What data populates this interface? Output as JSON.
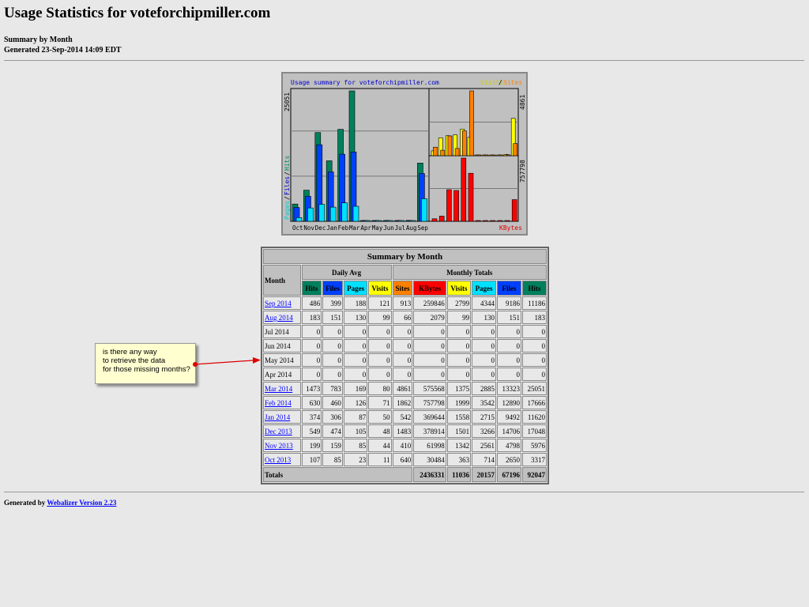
{
  "header": {
    "title": "Usage Statistics for voteforchipmiller.com",
    "subtitle": "Summary by Month",
    "generated": "Generated 23-Sep-2014 14:09 EDT"
  },
  "chart_data": {
    "type": "bar",
    "title": "Usage summary for voteforchipmiller.com",
    "categories": [
      "Oct",
      "Nov",
      "Dec",
      "Jan",
      "Feb",
      "Mar",
      "Apr",
      "May",
      "Jun",
      "Jul",
      "Aug",
      "Sep"
    ],
    "left_label_pages": "Pages",
    "left_label_files": "Files",
    "left_label_hits": "Hits",
    "sep": "/",
    "right_label_visits": "Visits",
    "right_label_sites": "Sites",
    "kbytes_label": "KBytes",
    "left_max": "25051",
    "sites_max": "4861",
    "kbytes_max": "757798",
    "series": [
      {
        "name": "Hits",
        "color": "#00805c",
        "values": [
          3317,
          5976,
          17048,
          11620,
          17666,
          25051,
          0,
          0,
          0,
          0,
          183,
          11186
        ]
      },
      {
        "name": "Files",
        "color": "#0040ff",
        "values": [
          2650,
          4798,
          14706,
          9492,
          12890,
          13323,
          0,
          0,
          0,
          0,
          151,
          9186
        ]
      },
      {
        "name": "Pages",
        "color": "#00e0ff",
        "values": [
          714,
          2561,
          3266,
          2715,
          3542,
          2885,
          0,
          0,
          0,
          0,
          130,
          4344
        ]
      },
      {
        "name": "Visits",
        "color": "#ffff00",
        "values": [
          363,
          1342,
          1501,
          1558,
          1999,
          1375,
          0,
          0,
          0,
          0,
          99,
          2799
        ]
      },
      {
        "name": "Sites",
        "color": "#ff8000",
        "values": [
          640,
          410,
          1483,
          542,
          1862,
          4861,
          0,
          0,
          0,
          0,
          66,
          913
        ]
      },
      {
        "name": "KBytes",
        "color": "#ff0000",
        "values": [
          30484,
          61998,
          378914,
          369644,
          757798,
          575568,
          0,
          0,
          0,
          0,
          2079,
          259846
        ]
      }
    ]
  },
  "table": {
    "title": "Summary by Month",
    "month_header": "Month",
    "daily_avg": "Daily Avg",
    "monthly_totals": "Monthly Totals",
    "columns": [
      {
        "label": "Hits",
        "bg": "#00805c",
        "fg": "#000"
      },
      {
        "label": "Files",
        "bg": "#0040ff",
        "fg": "#000"
      },
      {
        "label": "Pages",
        "bg": "#00e0ff",
        "fg": "#000"
      },
      {
        "label": "Visits",
        "bg": "#ffff00",
        "fg": "#000"
      },
      {
        "label": "Sites",
        "bg": "#ff8000",
        "fg": "#000"
      },
      {
        "label": "KBytes",
        "bg": "#ff0000",
        "fg": "#000"
      },
      {
        "label": "Visits",
        "bg": "#ffff00",
        "fg": "#000"
      },
      {
        "label": "Pages",
        "bg": "#00e0ff",
        "fg": "#000"
      },
      {
        "label": "Files",
        "bg": "#0040ff",
        "fg": "#000"
      },
      {
        "label": "Hits",
        "bg": "#00805c",
        "fg": "#000"
      }
    ],
    "rows": [
      {
        "month": "Sep 2014",
        "link": true,
        "v": [
          "486",
          "399",
          "188",
          "121",
          "913",
          "259846",
          "2799",
          "4344",
          "9186",
          "11186"
        ]
      },
      {
        "month": "Aug 2014",
        "link": true,
        "v": [
          "183",
          "151",
          "130",
          "99",
          "66",
          "2079",
          "99",
          "130",
          "151",
          "183"
        ]
      },
      {
        "month": "Jul 2014",
        "link": false,
        "v": [
          "0",
          "0",
          "0",
          "0",
          "0",
          "0",
          "0",
          "0",
          "0",
          "0"
        ]
      },
      {
        "month": "Jun 2014",
        "link": false,
        "v": [
          "0",
          "0",
          "0",
          "0",
          "0",
          "0",
          "0",
          "0",
          "0",
          "0"
        ]
      },
      {
        "month": "May 2014",
        "link": false,
        "v": [
          "0",
          "0",
          "0",
          "0",
          "0",
          "0",
          "0",
          "0",
          "0",
          "0"
        ]
      },
      {
        "month": "Apr 2014",
        "link": false,
        "v": [
          "0",
          "0",
          "0",
          "0",
          "0",
          "0",
          "0",
          "0",
          "0",
          "0"
        ]
      },
      {
        "month": "Mar 2014",
        "link": true,
        "v": [
          "1473",
          "783",
          "169",
          "80",
          "4861",
          "575568",
          "1375",
          "2885",
          "13323",
          "25051"
        ]
      },
      {
        "month": "Feb 2014",
        "link": true,
        "v": [
          "630",
          "460",
          "126",
          "71",
          "1862",
          "757798",
          "1999",
          "3542",
          "12890",
          "17666"
        ]
      },
      {
        "month": "Jan 2014",
        "link": true,
        "v": [
          "374",
          "306",
          "87",
          "50",
          "542",
          "369644",
          "1558",
          "2715",
          "9492",
          "11620"
        ]
      },
      {
        "month": "Dec 2013",
        "link": true,
        "v": [
          "549",
          "474",
          "105",
          "48",
          "1483",
          "378914",
          "1501",
          "3266",
          "14706",
          "17048"
        ]
      },
      {
        "month": "Nov 2013",
        "link": true,
        "v": [
          "199",
          "159",
          "85",
          "44",
          "410",
          "61998",
          "1342",
          "2561",
          "4798",
          "5976"
        ]
      },
      {
        "month": "Oct 2013",
        "link": true,
        "v": [
          "107",
          "85",
          "23",
          "11",
          "640",
          "30484",
          "363",
          "714",
          "2650",
          "3317"
        ]
      }
    ],
    "totals_label": "Totals",
    "totals": [
      "2436331",
      "11036",
      "20157",
      "67196",
      "92047"
    ]
  },
  "callout": {
    "line1": "is there any way",
    "line2": "to retrieve the data",
    "line3": "for those missing months?"
  },
  "footer": {
    "prefix": "Generated by ",
    "link": "Webalizer Version 2.23"
  }
}
